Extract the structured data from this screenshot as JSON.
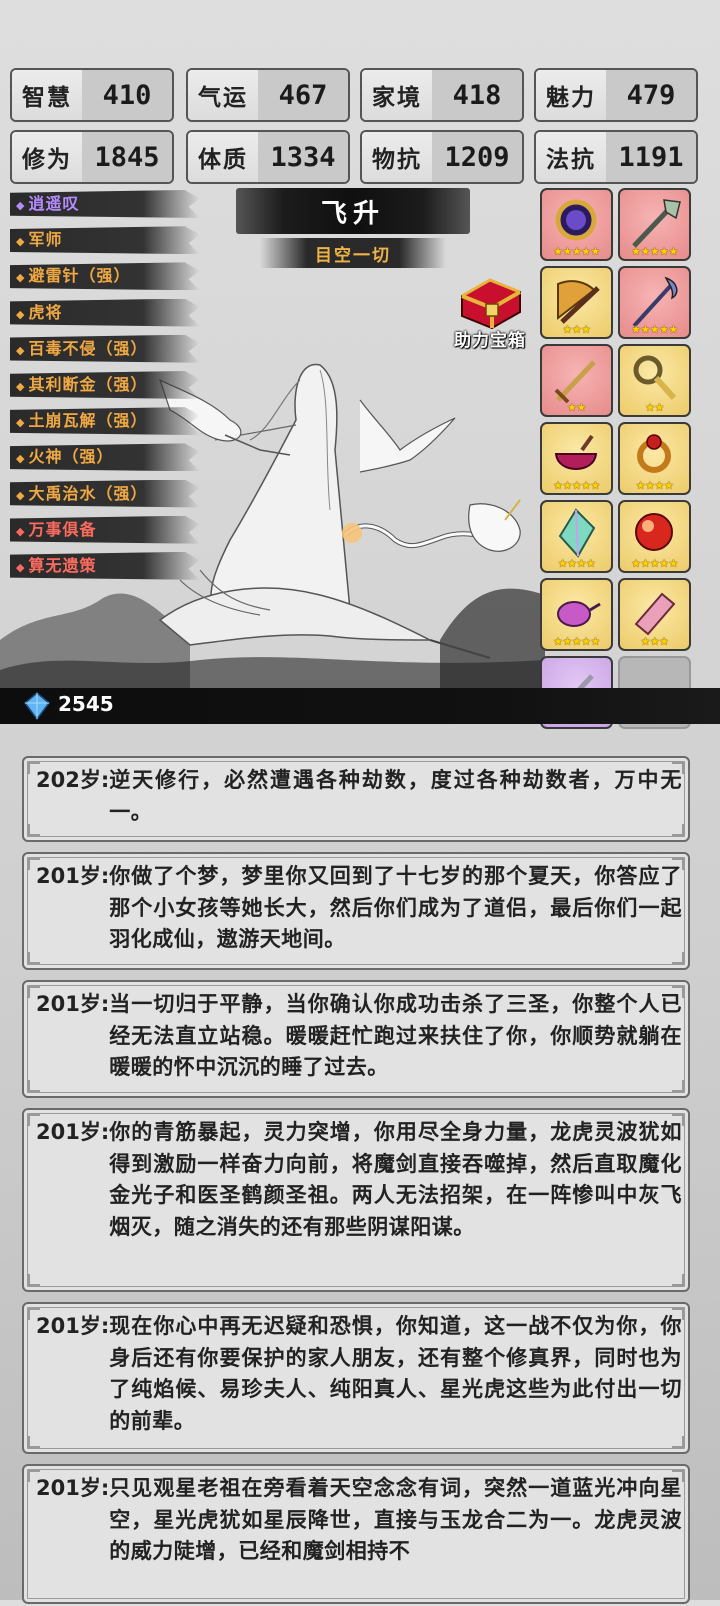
{
  "stats": [
    {
      "label": "智慧",
      "value": "410"
    },
    {
      "label": "气运",
      "value": "467"
    },
    {
      "label": "家境",
      "value": "418"
    },
    {
      "label": "魅力",
      "value": "479"
    },
    {
      "label": "修为",
      "value": "1845"
    },
    {
      "label": "体质",
      "value": "1334"
    },
    {
      "label": "物抗",
      "value": "1209"
    },
    {
      "label": "法抗",
      "value": "1191"
    }
  ],
  "talents": [
    {
      "label": "逍遥叹",
      "color": "#b48cff"
    },
    {
      "label": "军师",
      "color": "#f0a843"
    },
    {
      "label": "避雷针（强）",
      "color": "#f0a843"
    },
    {
      "label": "虎将",
      "color": "#f0a843"
    },
    {
      "label": "百毒不侵（强）",
      "color": "#f0a843"
    },
    {
      "label": "其利断金（强）",
      "color": "#f0a843"
    },
    {
      "label": "土崩瓦解（强）",
      "color": "#f0a843"
    },
    {
      "label": "火神（强）",
      "color": "#f0a843"
    },
    {
      "label": "大禹治水（强）",
      "color": "#f0a843"
    },
    {
      "label": "万事俱备",
      "color": "#ff6b5e"
    },
    {
      "label": "算无遗策",
      "color": "#ff6b5e"
    }
  ],
  "title": "飞升",
  "subtitle": "目空一切",
  "chest_label": "助力宝箱",
  "gems": "2545",
  "items": [
    {
      "icon": "mirror-icon",
      "rarity": "red",
      "stars": "★★★★★"
    },
    {
      "icon": "spear-icon",
      "rarity": "red",
      "stars": "★★★★★"
    },
    {
      "icon": "fan-icon",
      "rarity": "gold",
      "stars": "★★★"
    },
    {
      "icon": "halberd-icon",
      "rarity": "red",
      "stars": "★★★★★"
    },
    {
      "icon": "sword-icon",
      "rarity": "red",
      "stars": "★★"
    },
    {
      "icon": "key-icon",
      "rarity": "gold",
      "stars": "★★"
    },
    {
      "icon": "cauldron-icon",
      "rarity": "gold",
      "stars": "★★★★★"
    },
    {
      "icon": "ring-icon",
      "rarity": "gold",
      "stars": "★★★★"
    },
    {
      "icon": "crystal-icon",
      "rarity": "gold",
      "stars": "★★★★"
    },
    {
      "icon": "orb-icon",
      "rarity": "gold",
      "stars": "★★★★★"
    },
    {
      "icon": "teapot-icon",
      "rarity": "gold",
      "stars": "★★★★★"
    },
    {
      "icon": "scroll-icon",
      "rarity": "gold",
      "stars": "★★★"
    },
    {
      "icon": "dagger-icon",
      "rarity": "purple",
      "stars": "★"
    },
    {
      "icon": "",
      "rarity": "empty",
      "stars": ""
    }
  ],
  "log": [
    {
      "age": "202岁:",
      "text": "逆天修行，必然遭遇各种劫数，度过各种劫数者，万中无一。"
    },
    {
      "age": "201岁:",
      "text": "你做了个梦，梦里你又回到了十七岁的那个夏天，你答应了那个小女孩等她长大，然后你们成为了道侣，最后你们一起羽化成仙，遨游天地间。"
    },
    {
      "age": "201岁:",
      "text": "当一切归于平静，当你确认你成功击杀了三圣，你整个人已经无法直立站稳。暖暖赶忙跑过来扶住了你，你顺势就躺在暖暖的怀中沉沉的睡了过去。"
    },
    {
      "age": "201岁:",
      "text": "你的青筋暴起，灵力突增，你用尽全身力量，龙虎灵波犹如得到激励一样奋力向前，将魔剑直接吞噬掉，然后直取魔化金光子和医圣鹤颜圣祖。两人无法招架，在一阵惨叫中灰飞烟灭，随之消失的还有那些阴谋阳谋。"
    },
    {
      "age": "201岁:",
      "text": "现在你心中再无迟疑和恐惧，你知道，这一战不仅为你，你身后还有你要保护的家人朋友，还有整个修真界，同时也为了纯焰候、易珍夫人、纯阳真人、星光虎这些为此付出一切的前辈。"
    },
    {
      "age": "201岁:",
      "text": "只见观星老祖在旁看着天空念念有词，突然一道蓝光冲向星空，星光虎犹如星辰降世，直接与玉龙合二为一。龙虎灵波的威力陡增，已经和魔剑相持不"
    }
  ]
}
